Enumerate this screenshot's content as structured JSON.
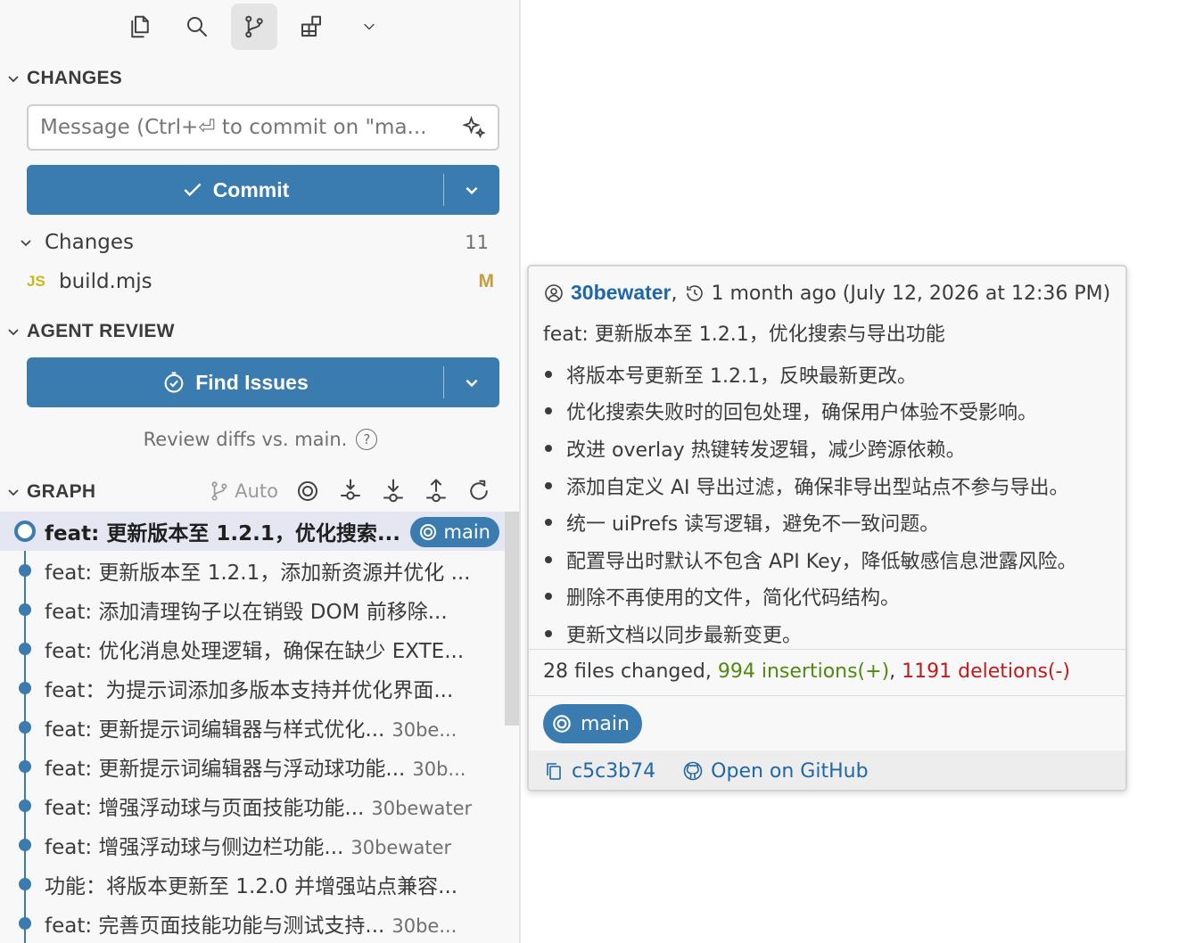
{
  "activity_bar": {
    "icons": [
      "explorer-icon",
      "search-icon",
      "source-control-icon",
      "extensions-icon",
      "chevron-down-icon"
    ],
    "active": "source-control-icon"
  },
  "changes_section": {
    "title": "CHANGES",
    "message_placeholder": "Message (Ctrl+⏎ to commit on \"ma...",
    "commit_label": "Commit",
    "group_label": "Changes",
    "group_count": "11",
    "files": [
      {
        "icon_label": "JS",
        "name": "build.mjs",
        "status": "M"
      }
    ]
  },
  "agent_review": {
    "title": "AGENT REVIEW",
    "button_label": "Find Issues",
    "note": "Review diffs vs. main."
  },
  "graph": {
    "title": "GRAPH",
    "auto_label": "Auto",
    "commits": [
      {
        "message": "feat: 更新版本至 1.2.1，优化搜索...",
        "author": "",
        "badge": "main"
      },
      {
        "message": "feat: 更新版本至 1.2.1，添加新资源并优化 ...",
        "author": ""
      },
      {
        "message": "feat: 添加清理钩子以在销毁 DOM 前移除...",
        "author": ""
      },
      {
        "message": "feat: 优化消息处理逻辑，确保在缺少 EXTE...",
        "author": ""
      },
      {
        "message": "feat：为提示词添加多版本支持并优化界面...",
        "author": ""
      },
      {
        "message": "feat: 更新提示词编辑器与样式优化...",
        "author": "30be..."
      },
      {
        "message": "feat: 更新提示词编辑器与浮动球功能...",
        "author": "30b..."
      },
      {
        "message": "feat: 增强浮动球与页面技能功能...",
        "author": "30bewater"
      },
      {
        "message": "feat: 增强浮动球与侧边栏功能...",
        "author": "30bewater"
      },
      {
        "message": "功能：将版本更新至 1.2.0 并增强站点兼容...",
        "author": ""
      },
      {
        "message": "feat: 完善页面技能功能与测试支持...",
        "author": "30be..."
      }
    ]
  },
  "hover_card": {
    "author": "30bewater",
    "author_suffix": ",",
    "time": "1 month ago (July 12, 2026 at 12:36 PM)",
    "subject": "feat: 更新版本至 1.2.1，优化搜索与导出功能",
    "bullets": [
      "将版本号更新至 1.2.1，反映最新更改。",
      "优化搜索失败时的回包处理，确保用户体验不受影响。",
      "改进 overlay 热键转发逻辑，减少跨源依赖。",
      "添加自定义 AI 导出过滤，确保非导出型站点不参与导出。",
      "统一 uiPrefs 读写逻辑，避免不一致问题。",
      "配置导出时默认不包含 API Key，降低敏感信息泄露风险。",
      "删除不再使用的文件，简化代码结构。",
      "更新文档以同步最新变更。"
    ],
    "stats": {
      "files": "28 files changed, ",
      "insertions": "994 insertions(+)",
      "sep": ", ",
      "deletions": "1191 deletions(-)"
    },
    "branch": "main",
    "hash": "c5c3b74",
    "github_link": "Open on GitHub"
  },
  "colors": {
    "accent": "#3a7bb0",
    "insertions": "#4f8a10",
    "deletions": "#c41a1a",
    "modified": "#c59d3c",
    "link": "#1f67a8"
  }
}
